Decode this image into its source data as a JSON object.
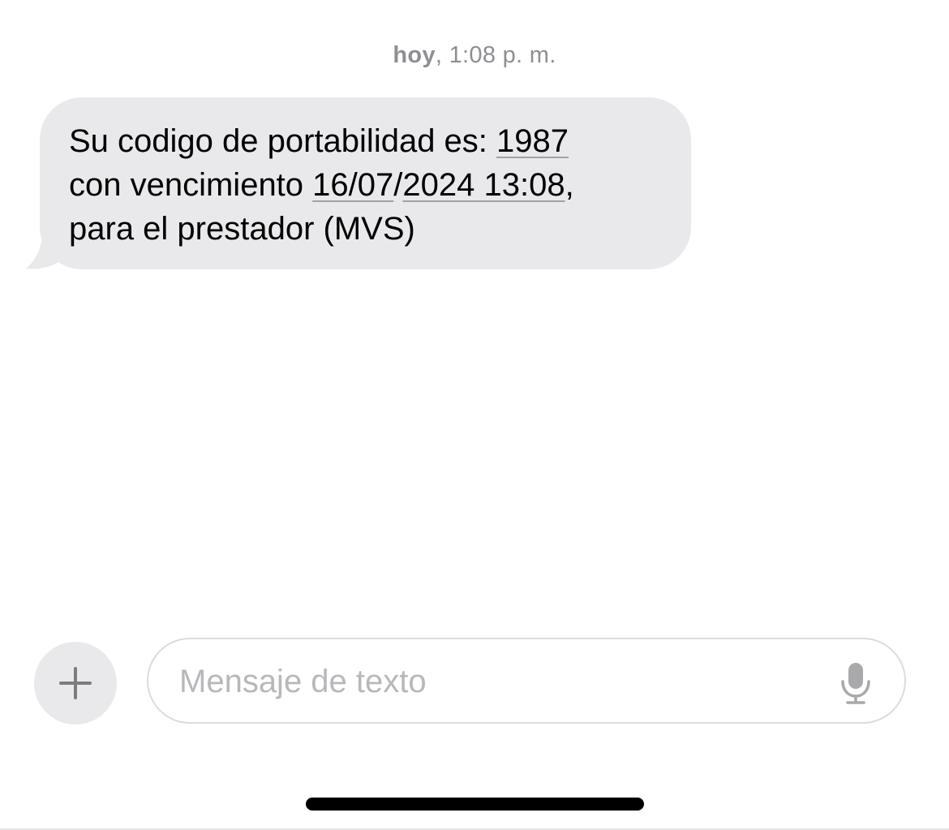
{
  "thread": {
    "timestamp_day": "hoy",
    "timestamp_time": ", 1:08 p. m."
  },
  "message": {
    "line1_prefix": "Su codigo de portabilidad es: ",
    "code": "1987",
    "line2_prefix": "con vencimiento ",
    "date_part1": "16/07",
    "date_sep": "/",
    "date_part2": "2024 13:08",
    "line2_suffix": ",",
    "line3": "para el prestador (MVS)"
  },
  "composer": {
    "placeholder": "Mensaje de texto",
    "value": ""
  },
  "colors": {
    "bubble": "#e9e9eb",
    "timestamp": "#8e8e93",
    "placeholder": "#b8b8bc"
  },
  "icons": {
    "add": "plus-icon",
    "dictation": "microphone-icon"
  }
}
